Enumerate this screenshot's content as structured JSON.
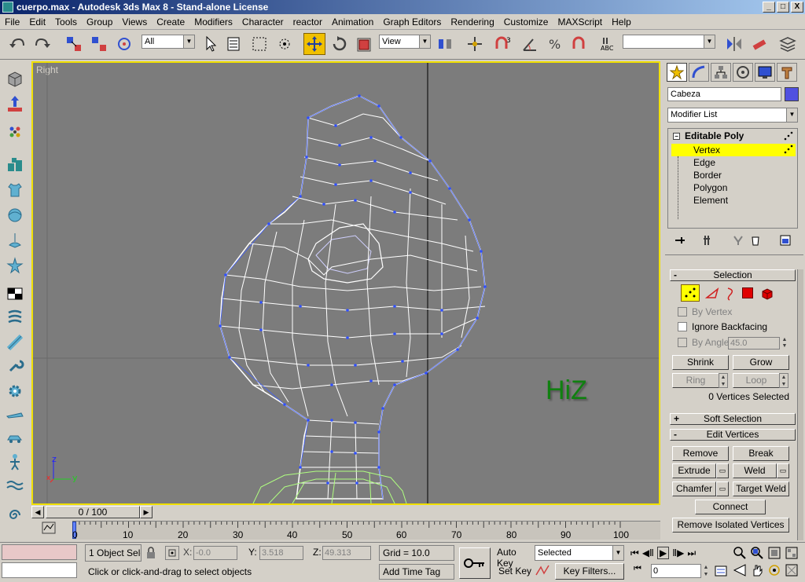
{
  "window": {
    "title": "cuerpo.max - Autodesk 3ds Max 8 - Stand-alone License",
    "buttons": [
      "_",
      "□",
      "X"
    ]
  },
  "menu": [
    "File",
    "Edit",
    "Tools",
    "Group",
    "Views",
    "Create",
    "Modifiers",
    "Character",
    "reactor",
    "Animation",
    "Graph Editors",
    "Rendering",
    "Customize",
    "MAXScript",
    "Help"
  ],
  "toolbar": {
    "selection_filter": "All",
    "reference_coord": "View",
    "named_selection": ""
  },
  "viewport": {
    "label": "Right",
    "watermark": "HiZ",
    "axis": {
      "z": "z",
      "y": "y",
      "x": "x"
    }
  },
  "command_panel": {
    "object_name": "Cabeza",
    "object_color": "#5050e0",
    "modifier_list": "Modifier List",
    "stack": {
      "root": "Editable Poly",
      "items": [
        "Vertex",
        "Edge",
        "Border",
        "Polygon",
        "Element"
      ],
      "selected": "Vertex"
    },
    "selection": {
      "title": "Selection",
      "by_vertex": "By Vertex",
      "ignore_backfacing": "Ignore Backfacing",
      "by_angle": "By Angle:",
      "angle_value": "45.0",
      "shrink": "Shrink",
      "grow": "Grow",
      "ring": "Ring",
      "loop": "Loop",
      "status": "0 Vertices Selected"
    },
    "soft_selection": {
      "title": "Soft Selection",
      "sign": "+"
    },
    "edit_vertices": {
      "title": "Edit Vertices",
      "sign": "-",
      "remove": "Remove",
      "break": "Break",
      "extrude": "Extrude",
      "weld": "Weld",
      "chamfer": "Chamfer",
      "target_weld": "Target Weld",
      "connect": "Connect",
      "remove_isolated": "Remove Isolated Vertices"
    }
  },
  "timeline": {
    "frame_display": "0 / 100",
    "ticks": [
      "0",
      "10",
      "20",
      "30",
      "40",
      "50",
      "60",
      "70",
      "80",
      "90",
      "100"
    ]
  },
  "status": {
    "selection": "1 Object Sele",
    "x_label": "X:",
    "x_value": "-0.0",
    "y_label": "Y:",
    "y_value": "3.518",
    "z_label": "Z:",
    "z_value": "49.313",
    "grid": "Grid = 10.0",
    "prompt": "Click or click-and-drag to select objects",
    "add_time_tag": "Add Time Tag",
    "auto_key": "Auto Key",
    "set_key": "Set Key",
    "key_mode": "Selected",
    "key_filters": "Key Filters...",
    "current_frame": "0"
  }
}
